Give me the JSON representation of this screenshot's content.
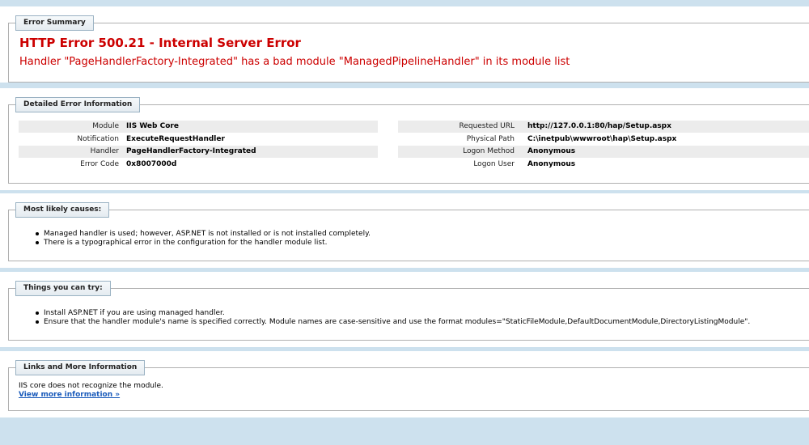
{
  "error_summary": {
    "legend": "Error Summary",
    "title": "HTTP Error 500.21 - Internal Server Error",
    "description": "Handler \"PageHandlerFactory-Integrated\" has a bad module \"ManagedPipelineHandler\" in its module list"
  },
  "detailed": {
    "legend": "Detailed Error Information",
    "left": [
      {
        "label": "Module",
        "value": "IIS Web Core"
      },
      {
        "label": "Notification",
        "value": "ExecuteRequestHandler"
      },
      {
        "label": "Handler",
        "value": "PageHandlerFactory-Integrated"
      },
      {
        "label": "Error Code",
        "value": "0x8007000d"
      }
    ],
    "right": [
      {
        "label": "Requested URL",
        "value": "http://127.0.0.1:80/hap/Setup.aspx"
      },
      {
        "label": "Physical Path",
        "value": "C:\\inetpub\\wwwroot\\hap\\Setup.aspx"
      },
      {
        "label": "Logon Method",
        "value": "Anonymous"
      },
      {
        "label": "Logon User",
        "value": "Anonymous"
      }
    ]
  },
  "causes": {
    "legend": "Most likely causes:",
    "items": [
      "Managed handler is used; however, ASP.NET is not installed or is not installed completely.",
      "There is a typographical error in the configuration for the handler module list."
    ]
  },
  "try": {
    "legend": "Things you can try:",
    "items": [
      "Install ASP.NET if you are using managed handler.",
      "Ensure that the handler module's name is specified correctly. Module names are case-sensitive and use the format modules=\"StaticFileModule,DefaultDocumentModule,DirectoryListingModule\"."
    ]
  },
  "links": {
    "legend": "Links and More Information",
    "text": "IIS core does not recognize the module.",
    "link": "View more information »"
  }
}
